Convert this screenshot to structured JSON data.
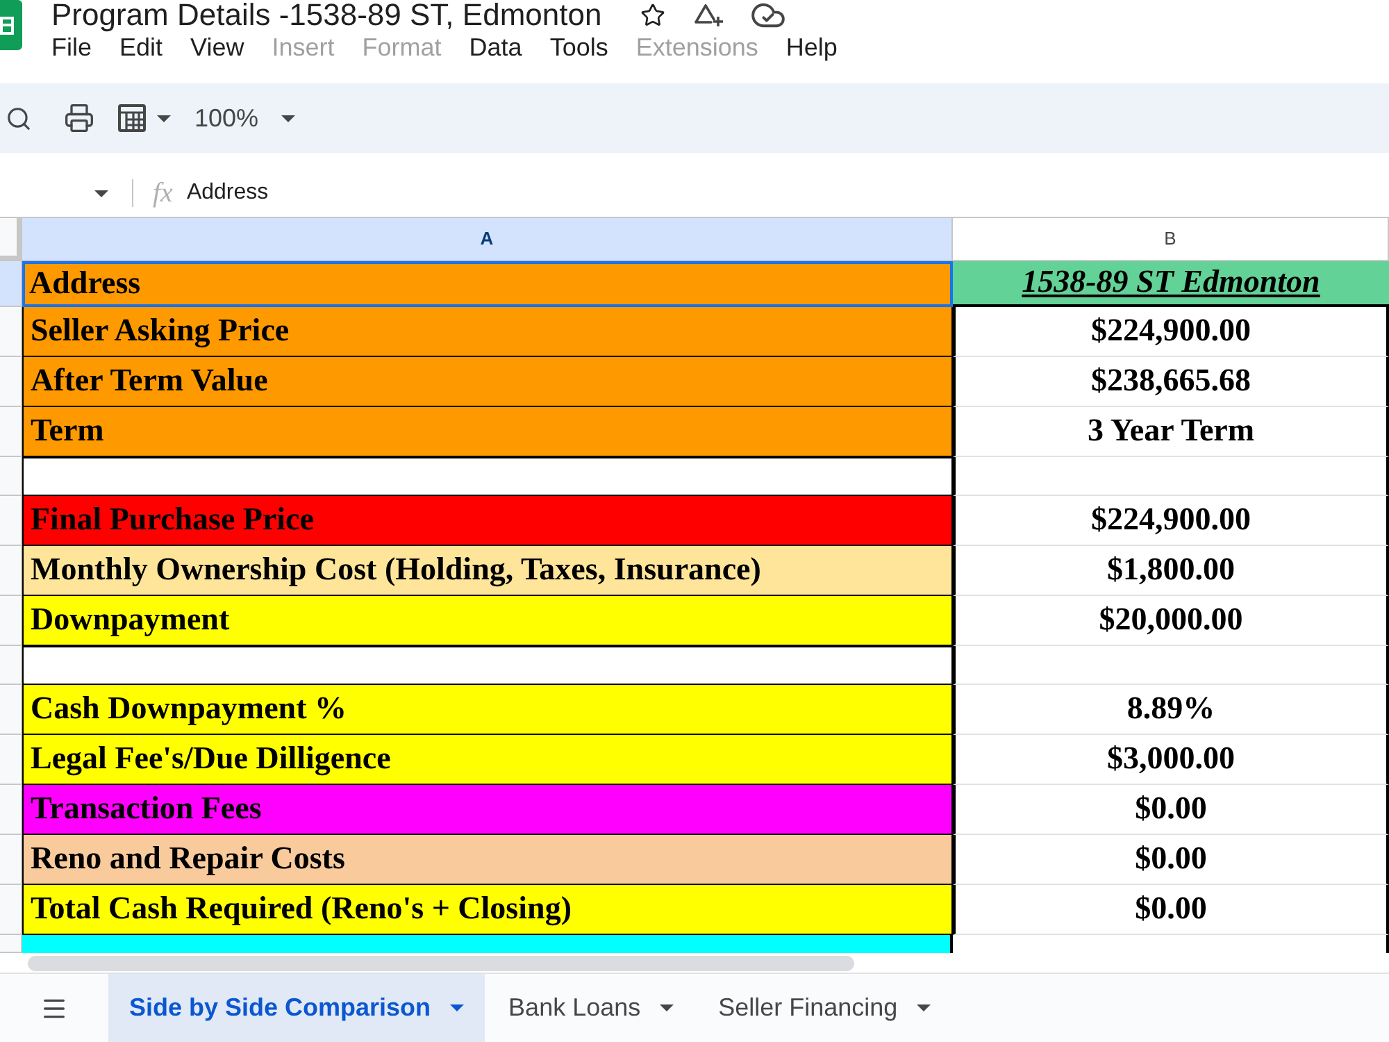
{
  "document": {
    "title": "Program Details -1538-89 ST, Edmonton"
  },
  "menu": [
    {
      "label": "File",
      "disabled": false
    },
    {
      "label": "Edit",
      "disabled": false
    },
    {
      "label": "View",
      "disabled": false
    },
    {
      "label": "Insert",
      "disabled": true
    },
    {
      "label": "Format",
      "disabled": true
    },
    {
      "label": "Data",
      "disabled": false
    },
    {
      "label": "Tools",
      "disabled": false
    },
    {
      "label": "Extensions",
      "disabled": true
    },
    {
      "label": "Help",
      "disabled": false
    }
  ],
  "toolbar": {
    "zoom": "100%"
  },
  "formula_bar": {
    "function_label": "fx",
    "value": "Address"
  },
  "columns": [
    {
      "label": "A",
      "selected": true
    },
    {
      "label": "B",
      "selected": false
    }
  ],
  "rows": [
    {
      "kind": "address",
      "label": "Address",
      "value": "1538-89 ST Edmonton",
      "color": "#ff9900",
      "selected": true
    },
    {
      "kind": "data",
      "label": "Seller Asking Price",
      "value": "$224,900.00",
      "color": "#ff9900",
      "selected": false
    },
    {
      "kind": "data",
      "label": "After Term Value",
      "value": "$238,665.68",
      "color": "#ff9900",
      "selected": false
    },
    {
      "kind": "data",
      "label": "Term",
      "value": "3 Year Term",
      "color": "#ff9900",
      "selected": false
    },
    {
      "kind": "blank",
      "color": "#ffffff",
      "selected": false
    },
    {
      "kind": "data",
      "label": "Final Purchase Price",
      "value": "$224,900.00",
      "color": "#ff0000",
      "selected": false
    },
    {
      "kind": "data",
      "label": "Monthly Ownership Cost (Holding, Taxes, Insurance)",
      "value": "$1,800.00",
      "color": "#ffe599",
      "selected": false
    },
    {
      "kind": "data",
      "label": "Downpayment",
      "value": "$20,000.00",
      "color": "#ffff00",
      "selected": false
    },
    {
      "kind": "blank",
      "color": "#ffffff",
      "selected": false
    },
    {
      "kind": "data",
      "label": "Cash Downpayment %",
      "value": "8.89%",
      "color": "#ffff00",
      "selected": false
    },
    {
      "kind": "data",
      "label": "Legal Fee's/Due Dilligence",
      "value": "$3,000.00",
      "color": "#ffff00",
      "selected": false
    },
    {
      "kind": "data",
      "label": "Transaction Fees",
      "value": "$0.00",
      "color": "#ff00ff",
      "selected": false
    },
    {
      "kind": "data",
      "label": "Reno and Repair Costs",
      "value": "$0.00",
      "color": "#f9cb9c",
      "selected": false
    },
    {
      "kind": "data",
      "label": "Total Cash Required (Reno's + Closing)",
      "value": "$0.00",
      "color": "#ffff00",
      "selected": false
    },
    {
      "kind": "partial",
      "color": "#00ffff",
      "selected": false
    }
  ],
  "sheet_tabs": [
    {
      "label": "Side by Side Comparison",
      "selected": true
    },
    {
      "label": "Bank Loans",
      "selected": false
    },
    {
      "label": "Seller Financing",
      "selected": false
    }
  ]
}
